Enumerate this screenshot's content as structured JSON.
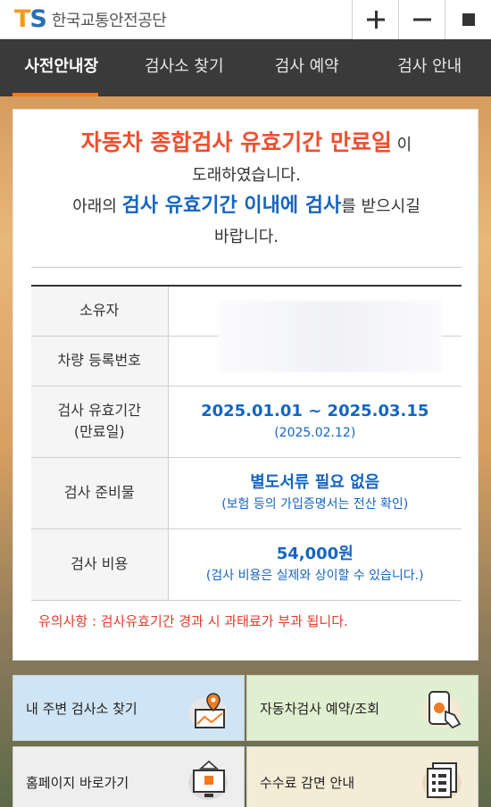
{
  "header": {
    "logo_mark_t": "T",
    "logo_mark_s": "S",
    "org_name": "한국교통안전공단",
    "buttons": [
      "plus-icon",
      "minus-icon",
      "square-icon"
    ]
  },
  "nav": {
    "tabs": [
      {
        "label": "사전안내장",
        "active": true
      },
      {
        "label": "검사소 찾기",
        "active": false
      },
      {
        "label": "검사 예약",
        "active": false
      },
      {
        "label": "검사 안내",
        "active": false
      }
    ]
  },
  "notice": {
    "line1_highlight": "자동차 종합검사 유효기간 만료일",
    "line1_suffix": " 이",
    "line2": "도래하였습니다.",
    "line3_prefix": "아래의 ",
    "line3_highlight": "검사 유효기간 이내에 검사",
    "line3_suffix": "를 받으시길",
    "line4": "바랍니다."
  },
  "table": {
    "owner_label": "소유자",
    "plate_label": "차량 등록번호",
    "validity_label_1": "검사 유효기간",
    "validity_label_2": "(만료일)",
    "validity_range": "2025.01.01 ~ 2025.03.15",
    "validity_expiry": "(2025.02.12)",
    "prep_label": "검사 준비물",
    "prep_main": "별도서류 필요 없음",
    "prep_sub": "(보험 등의 가입증명서는 전산 확인)",
    "fee_label": "검사 비용",
    "fee_main": "54,000원",
    "fee_sub": "(검사 비용은 실제와 상이할 수 있습니다.)"
  },
  "warning": "유의사항 : 검사유효기간 경과 시 과태료가 부과 됩니다.",
  "tiles": {
    "nearby": "내 주변 검사소 찾기",
    "reserve": "자동차검사 예약/조회",
    "homepage": "홈페이지 바로가기",
    "fee_discount": "수수료 감면 안내"
  },
  "colors": {
    "accent_orange": "#f47a20",
    "red": "#ee4f30",
    "blue": "#1565c0",
    "nav_bg": "#3a3a3a"
  }
}
